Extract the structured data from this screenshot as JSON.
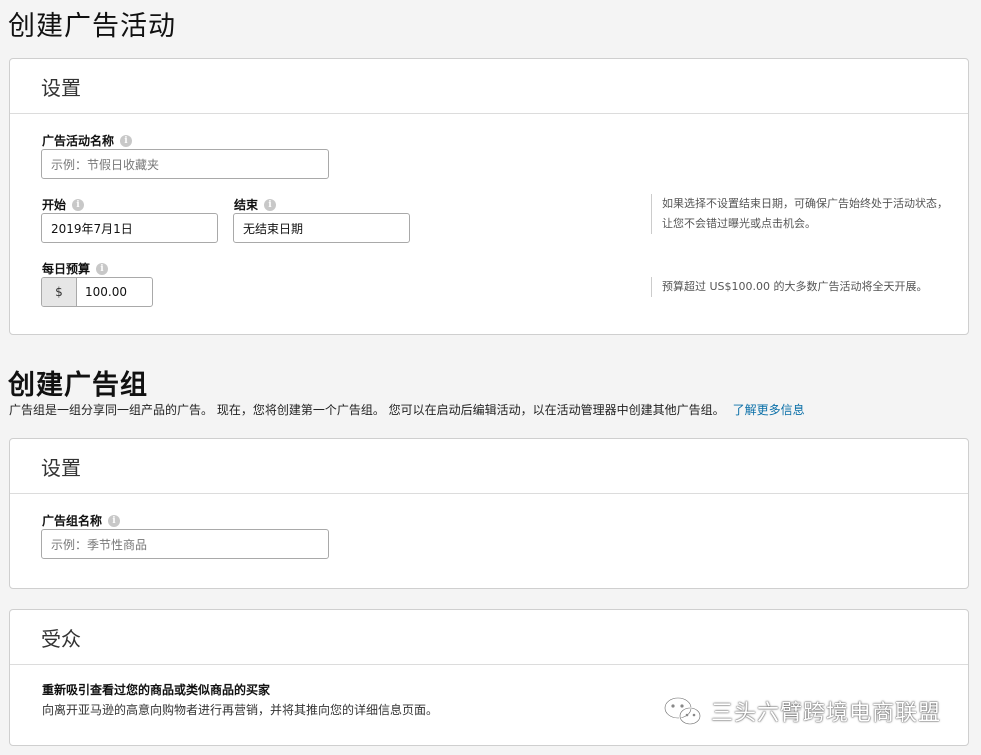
{
  "page": {
    "title": "创建广告活动"
  },
  "settings_card": {
    "header": "设置",
    "campaign_name": {
      "label": "广告活动名称",
      "placeholder": "示例：节假日收藏夹"
    },
    "start": {
      "label": "开始",
      "value": "2019年7月1日"
    },
    "end": {
      "label": "结束",
      "value": "无结束日期"
    },
    "end_hint": "如果选择不设置结束日期，可确保广告始终处于活动状态，让您不会错过曝光或点击机会。",
    "budget": {
      "label": "每日预算",
      "currency": "$",
      "value": "100.00"
    },
    "budget_hint": "预算超过 US$100.00 的大多数广告活动将全天开展。"
  },
  "ad_group": {
    "title": "创建广告组",
    "description": "广告组是一组分享同一组产品的广告。 现在，您将创建第一个广告组。 您可以在启动后编辑活动，以在活动管理器中创建其他广告组。",
    "learn_more": "了解更多信息",
    "card": {
      "header": "设置",
      "name": {
        "label": "广告组名称",
        "placeholder": "示例：季节性商品"
      }
    }
  },
  "audience_card": {
    "header": "受众",
    "option_title": "重新吸引查看过您的商品或类似商品的买家",
    "option_desc": "向离开亚马逊的高意向购物者进行再营销，并将其推向您的详细信息页面。"
  },
  "watermark": {
    "text": "三头六臂跨境电商联盟",
    "icon": "wechat-icon"
  },
  "info_icon_glyph": "i"
}
